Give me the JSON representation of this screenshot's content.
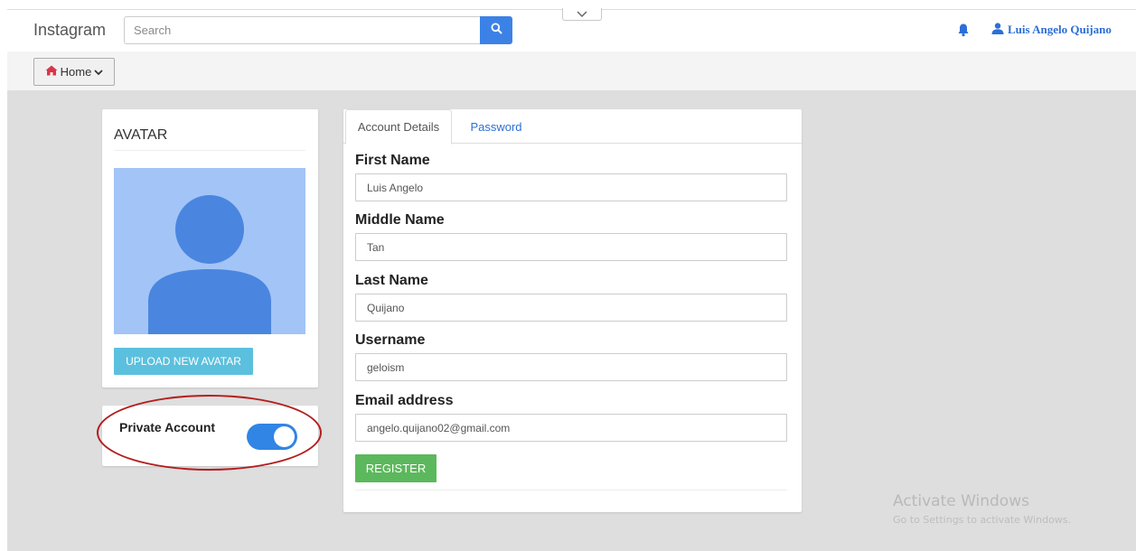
{
  "navbar": {
    "brand": "Instagram",
    "search": {
      "placeholder": "Search",
      "value": ""
    },
    "user_name": "Luis Angelo Quijano"
  },
  "subbar": {
    "home_label": "Home"
  },
  "avatar_card": {
    "title": "AVATAR",
    "upload_label": "UPLOAD NEW AVATAR"
  },
  "privacy_card": {
    "label": "Private Account",
    "toggle_on": true
  },
  "form": {
    "tabs": [
      {
        "label": "Account Details",
        "active": true
      },
      {
        "label": "Password",
        "active": false
      }
    ],
    "fields": [
      {
        "label": "First Name",
        "value": "Luis Angelo"
      },
      {
        "label": "Middle Name",
        "value": "Tan"
      },
      {
        "label": "Last Name",
        "value": "Quijano"
      },
      {
        "label": "Username",
        "value": "geloism"
      },
      {
        "label": "Email address",
        "value": "angelo.quijano02@gmail.com"
      }
    ],
    "register_label": "REGISTER"
  },
  "watermark": {
    "title": "Activate Windows",
    "subtitle": "Go to Settings to activate Windows."
  },
  "colors": {
    "primary": "#3c82e6",
    "link": "#2c6fd6",
    "info_button": "#5bc0de",
    "success_button": "#5cb85c",
    "toggle_on": "#3185e4",
    "highlight": "#b41e1e",
    "avatar_bg": "#a3c4f6",
    "avatar_silhouette": "#4a86e0"
  }
}
